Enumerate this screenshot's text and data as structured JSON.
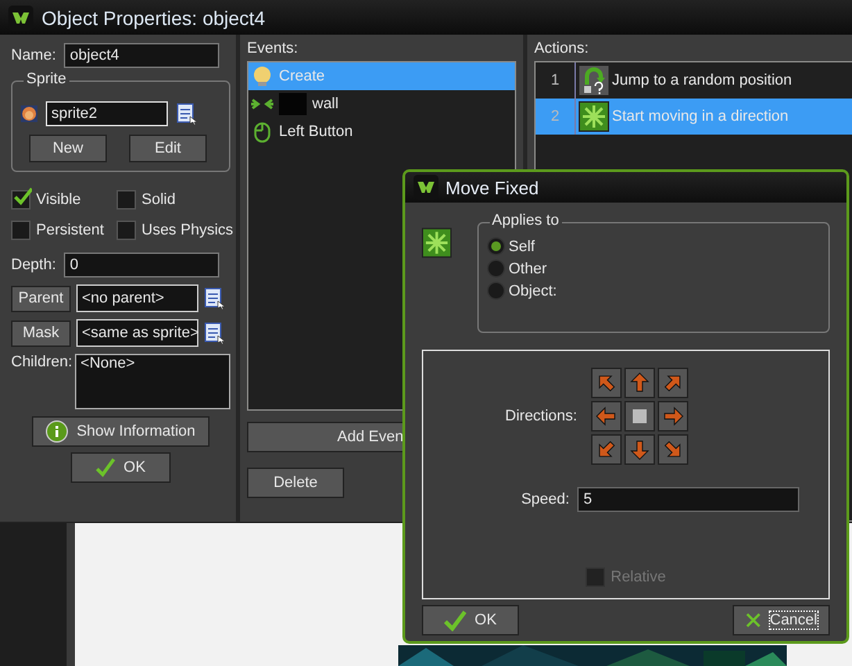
{
  "window": {
    "title": "Object Properties: object4"
  },
  "object": {
    "name_label": "Name:",
    "name": "object4",
    "sprite": {
      "legend": "Sprite",
      "value": "sprite2",
      "buttons": [
        "New",
        "Edit"
      ]
    },
    "flags": [
      {
        "label": "Visible",
        "checked": true
      },
      {
        "label": "Solid",
        "checked": false
      },
      {
        "label": "Persistent",
        "checked": false
      },
      {
        "label": "Uses Physics",
        "checked": false
      }
    ],
    "depth_label": "Depth:",
    "depth": "0",
    "parent_button": "Parent",
    "parent": "<no parent>",
    "mask_button": "Mask",
    "mask": "<same as sprite>",
    "children_label": "Children:",
    "children": "<None>",
    "info_button": "Show Information",
    "ok_button": "OK"
  },
  "events": {
    "label": "Events:",
    "items": [
      {
        "label": "Create",
        "kind": "create",
        "selected": true
      },
      {
        "label": "wall",
        "kind": "collision",
        "selected": false
      },
      {
        "label": "Left Button",
        "kind": "mouse",
        "selected": false
      }
    ],
    "add_button": "Add Even",
    "delete_button": "Delete"
  },
  "actions": {
    "label": "Actions:",
    "items": [
      {
        "number": "1",
        "label": "Jump to a random position",
        "kind": "jump",
        "selected": false
      },
      {
        "number": "2",
        "label": "Start moving in a direction",
        "kind": "move",
        "selected": true
      }
    ]
  },
  "dialog": {
    "title": "Move Fixed",
    "applies_legend": "Applies to",
    "applies": [
      {
        "label": "Self",
        "selected": true
      },
      {
        "label": "Other",
        "selected": false
      },
      {
        "label": "Object:",
        "selected": false
      }
    ],
    "directions_label": "Directions:",
    "speed_label": "Speed:",
    "speed": "5",
    "relative": {
      "label": "Relative",
      "checked": false,
      "disabled": true
    },
    "ok_button": "OK",
    "cancel_button": "Cancel"
  }
}
